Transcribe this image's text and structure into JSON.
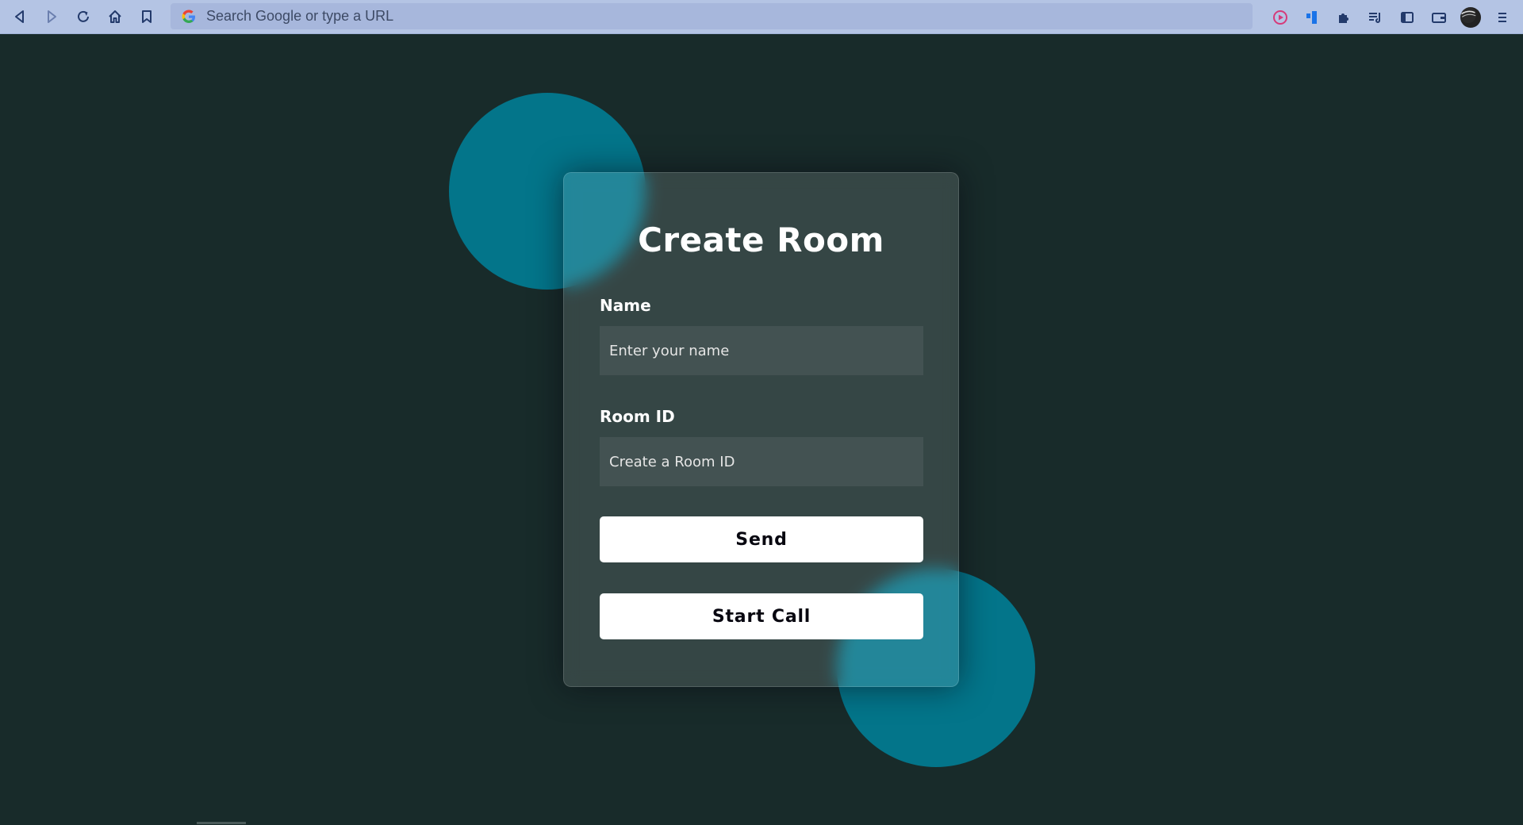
{
  "browser": {
    "omnibox_placeholder": "Search Google or type a URL",
    "icons": [
      "back-icon",
      "forward-icon",
      "reload-icon",
      "home-icon",
      "bookmark-icon",
      "google-icon",
      "media-icon",
      "extension-blue-icon",
      "puzzle-icon",
      "reading-list-icon",
      "sidebar-icon",
      "wallet-icon",
      "profile-avatar",
      "menu-icon"
    ]
  },
  "form": {
    "title": "Create Room",
    "name_label": "Name",
    "name_placeholder": "Enter your name",
    "room_label": "Room ID",
    "room_placeholder": "Create a Room ID",
    "send_label": "Send",
    "start_call_label": "Start Call"
  },
  "colors": {
    "background": "#182b2a",
    "accent_circle": "#03758a",
    "button_bg": "#ffffff",
    "toolbar": "#b4c4e4"
  }
}
